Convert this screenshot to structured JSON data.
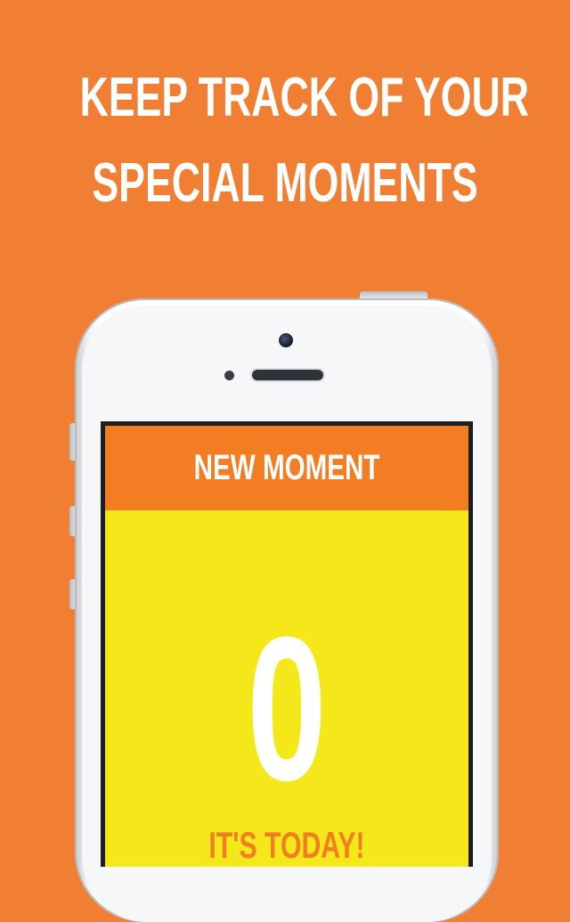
{
  "headline": {
    "line1": "KEEP TRACK OF YOUR",
    "line2": "SPECIAL MOMENTS"
  },
  "app": {
    "title": "NEW MOMENT",
    "counter_value": "0",
    "caption": "IT'S TODAY!"
  },
  "colors": {
    "background": "#F07F33",
    "header": "#F27D22",
    "body": "#F4E81A",
    "text_light": "#FFFFFF"
  }
}
